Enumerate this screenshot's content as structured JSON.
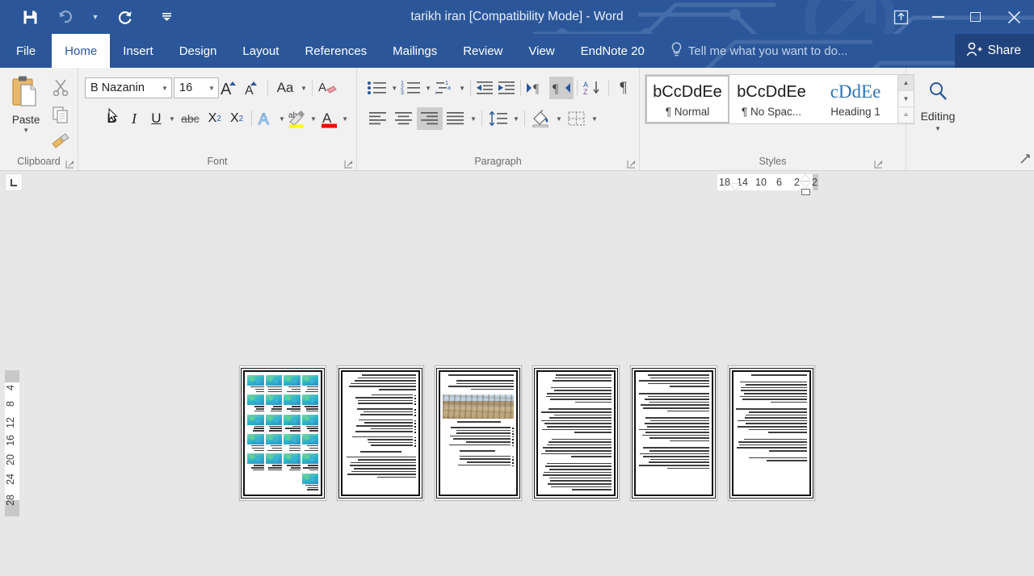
{
  "window": {
    "title": "tarikh iran [Compatibility Mode] - Word",
    "quick_access": [
      {
        "name": "save",
        "icon": "save-icon"
      },
      {
        "name": "undo",
        "icon": "undo-icon"
      },
      {
        "name": "redo",
        "icon": "redo-icon"
      },
      {
        "name": "customize-qat",
        "icon": "chevron-down-icon"
      }
    ],
    "controls": {
      "ribbon_display_options": "ribbon-display-options-icon",
      "minimize": "minimize-icon",
      "restore": "restore-icon",
      "close": "close-icon"
    }
  },
  "tabs": [
    {
      "label": "File",
      "active": false
    },
    {
      "label": "Home",
      "active": true
    },
    {
      "label": "Insert",
      "active": false
    },
    {
      "label": "Design",
      "active": false
    },
    {
      "label": "Layout",
      "active": false
    },
    {
      "label": "References",
      "active": false
    },
    {
      "label": "Mailings",
      "active": false
    },
    {
      "label": "Review",
      "active": false
    },
    {
      "label": "View",
      "active": false
    },
    {
      "label": "EndNote 20",
      "active": false
    }
  ],
  "tell_me": {
    "placeholder": "Tell me what you want to do...",
    "icon": "lightbulb-icon"
  },
  "share": {
    "label": "Share",
    "icon": "person-add-icon"
  },
  "ribbon": {
    "clipboard": {
      "group_label": "Clipboard",
      "paste_label": "Paste",
      "paste_icon": "paste-icon",
      "cut_icon": "scissors-icon",
      "copy_icon": "copy-icon",
      "format_painter_icon": "format-painter-icon",
      "dialog_launcher": "dialog-launcher-icon"
    },
    "font": {
      "group_label": "Font",
      "font_name": "B Nazanin",
      "font_size": "16",
      "grow_font_icon": "grow-font-icon",
      "shrink_font_icon": "shrink-font-icon",
      "change_case_label": "Aa",
      "change_case_icon": "change-case-icon",
      "clear_formatting_icon": "clear-formatting-icon",
      "bold_label": "B",
      "italic_label": "I",
      "underline_label": "U",
      "strikethrough_label": "abc",
      "subscript_label": "X",
      "subscript_sub": "2",
      "superscript_label": "X",
      "superscript_sup": "2",
      "text_effects_icon": "text-effects-icon",
      "highlight_icon": "text-highlight-icon",
      "highlight_color": "#ffff00",
      "font_color_icon": "font-color-icon",
      "font_color": "#ff0000",
      "dialog_launcher": "dialog-launcher-icon"
    },
    "paragraph": {
      "group_label": "Paragraph",
      "bullets_icon": "bullets-icon",
      "numbering_icon": "numbering-icon",
      "multilevel_icon": "multilevel-list-icon",
      "decrease_indent_icon": "decrease-indent-icon",
      "increase_indent_icon": "increase-indent-icon",
      "ltr_icon": "left-to-right-icon",
      "rtl_icon": "right-to-left-icon",
      "rtl_active": true,
      "sort_icon": "sort-icon",
      "show_marks_icon": "show-formatting-marks-icon",
      "align_left_icon": "align-left-icon",
      "align_center_icon": "align-center-icon",
      "align_right_icon": "align-right-icon",
      "align_right_active": true,
      "justify_icon": "justify-icon",
      "line_spacing_icon": "line-spacing-icon",
      "shading_icon": "shading-icon",
      "borders_icon": "borders-icon",
      "dialog_launcher": "dialog-launcher-icon"
    },
    "styles": {
      "group_label": "Styles",
      "items": [
        {
          "preview": "bCcDdEe",
          "name": "¶ Normal",
          "selected": true
        },
        {
          "preview": "bCcDdEe",
          "name": "¶ No Spac...",
          "selected": false
        },
        {
          "preview": "cDdEe",
          "name": "Heading 1",
          "selected": false,
          "heading": true
        }
      ],
      "scroll_up_icon": "scroll-up-icon",
      "scroll_down_icon": "scroll-down-icon",
      "more_styles_icon": "more-styles-icon",
      "dialog_launcher": "dialog-launcher-icon"
    },
    "editing": {
      "group_label": "Editing",
      "find_icon": "search-icon",
      "dropdown_icon": "chevron-down-icon"
    },
    "collapse_ribbon_icon": "collapse-ribbon-icon"
  },
  "rulers": {
    "horizontal_numbers": [
      "18",
      "14",
      "10",
      "6",
      "2",
      "2"
    ],
    "vertical_numbers": [
      "4",
      "8",
      "12",
      "16",
      "20",
      "24",
      "28"
    ],
    "tab_stop_selector_icon": "tab-stop-left-icon"
  },
  "document": {
    "view": "multiple-pages",
    "page_count": 6,
    "pages": [
      {
        "index": 1,
        "name": "page-thumbnail-1",
        "type": "map-grid"
      },
      {
        "index": 2,
        "name": "page-thumbnail-2",
        "type": "bulleted-text"
      },
      {
        "index": 3,
        "name": "page-thumbnail-3",
        "type": "photo-text"
      },
      {
        "index": 4,
        "name": "page-thumbnail-4",
        "type": "text"
      },
      {
        "index": 5,
        "name": "page-thumbnail-5",
        "type": "text"
      },
      {
        "index": 6,
        "name": "page-thumbnail-6",
        "type": "text"
      }
    ]
  },
  "colors": {
    "title_bar": "#2b579a",
    "share_bar": "#21437d",
    "ribbon_bg": "#f1f1f1",
    "canvas_bg": "#e7e7e7",
    "accent_blue": "#2e74b5",
    "highlight_yellow": "#ffff00",
    "font_color_red": "#ff0000"
  }
}
